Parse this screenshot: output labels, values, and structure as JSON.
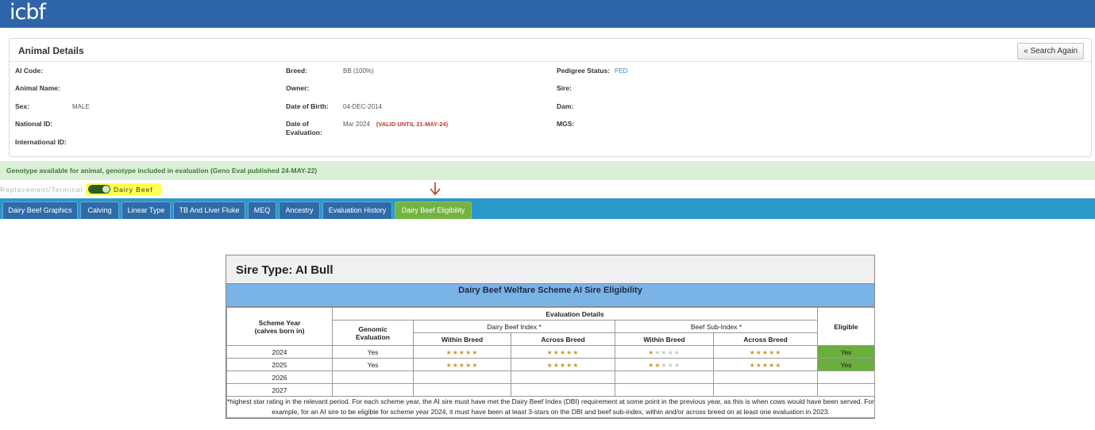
{
  "header": {
    "logo_text": "icbf"
  },
  "panel": {
    "title": "Animal Details",
    "search_again_label": "« Search Again",
    "fields": {
      "ai_code": {
        "label": "AI Code:",
        "value": ""
      },
      "animal_name": {
        "label": "Animal Name:",
        "value": ""
      },
      "sex": {
        "label": "Sex:",
        "value": "MALE"
      },
      "national_id": {
        "label": "National ID:",
        "value": ""
      },
      "international_id": {
        "label": "International ID:",
        "value": ""
      },
      "breed": {
        "label": "Breed:",
        "value": "BB (100%)"
      },
      "owner": {
        "label": "Owner:",
        "value": ""
      },
      "dob": {
        "label": "Date of Birth:",
        "value": "04-DEC-2014"
      },
      "date_eval": {
        "label_line1": "Date of",
        "label_line2": "Evaluation:",
        "value": "Mar 2024",
        "valid": "(VALID UNTIL 21-MAY-24)"
      },
      "pedigree": {
        "label": "Pedigree Status:",
        "value": "PED"
      },
      "sire": {
        "label": "Sire:",
        "value": ""
      },
      "dam": {
        "label": "Dam:",
        "value": ""
      },
      "mgs": {
        "label": "MGS:",
        "value": ""
      }
    }
  },
  "genotype_notice": "Genotype available for animal, genotype included in evaluation (Geno Eval published 24-MAY-22)",
  "toggle": {
    "left_label": "Replacement/Terminal",
    "right_label": "Dairy Beef",
    "on": true
  },
  "tabs": [
    {
      "label": "Dairy Beef Graphics",
      "active": false
    },
    {
      "label": "Calving",
      "active": false
    },
    {
      "label": "Linear Type",
      "active": false
    },
    {
      "label": "TB And Liver Fluke",
      "active": false
    },
    {
      "label": "MEQ",
      "active": false
    },
    {
      "label": "Ancestry",
      "active": false
    },
    {
      "label": "Evaluation History",
      "active": false
    },
    {
      "label": "Dairy Beef Eligibility",
      "active": true
    }
  ],
  "eligibility": {
    "title": "Sire Type: AI Bull",
    "subtitle": "Dairy Beef Welfare Scheme AI Sire Eligibility",
    "headers": {
      "scheme_year_line1": "Scheme Year",
      "scheme_year_line2": "(calves born in)",
      "evaluation_details": "Evaluation Details",
      "genomic_line1": "Genomic",
      "genomic_line2": "Evaluation",
      "dbi": "Dairy Beef Index *",
      "beef_sub": "Beef Sub-Index *",
      "within_breed": "Within Breed",
      "across_breed": "Across Breed",
      "eligible": "Eligible"
    },
    "rows": [
      {
        "year": "2024",
        "genomic": "Yes",
        "dbi_within": 5,
        "dbi_across": 5,
        "beef_within": 1,
        "beef_across": 5,
        "eligible": "Yes"
      },
      {
        "year": "2025",
        "genomic": "Yes",
        "dbi_within": 5,
        "dbi_across": 5,
        "beef_within": 2,
        "beef_across": 5,
        "eligible": "Yes"
      },
      {
        "year": "2026",
        "genomic": "",
        "dbi_within": 0,
        "dbi_across": 0,
        "beef_within": 0,
        "beef_across": 0,
        "eligible": ""
      },
      {
        "year": "2027",
        "genomic": "",
        "dbi_within": 0,
        "dbi_across": 0,
        "beef_within": 0,
        "beef_across": 0,
        "eligible": ""
      }
    ],
    "footnote": "*highest star rating in the relevant period. For each scheme year, the AI sire must have met the Dairy Beef Index (DBI) requirement at some point in the previous year, as this is when cows would have been served. For example, for an AI sire to be eligible for scheme year 2024, it must have been at least 3-stars on the DBI and beef sub-index, within and/or across breed on at least one evaluation in 2023."
  },
  "colors": {
    "header_blue": "#2e64a8",
    "tab_bar": "#2a98c8",
    "tab": "#2f6ba9",
    "tab_active": "#73b340",
    "eligible_green": "#6aae3c",
    "star_gold": "#c99a2e"
  }
}
